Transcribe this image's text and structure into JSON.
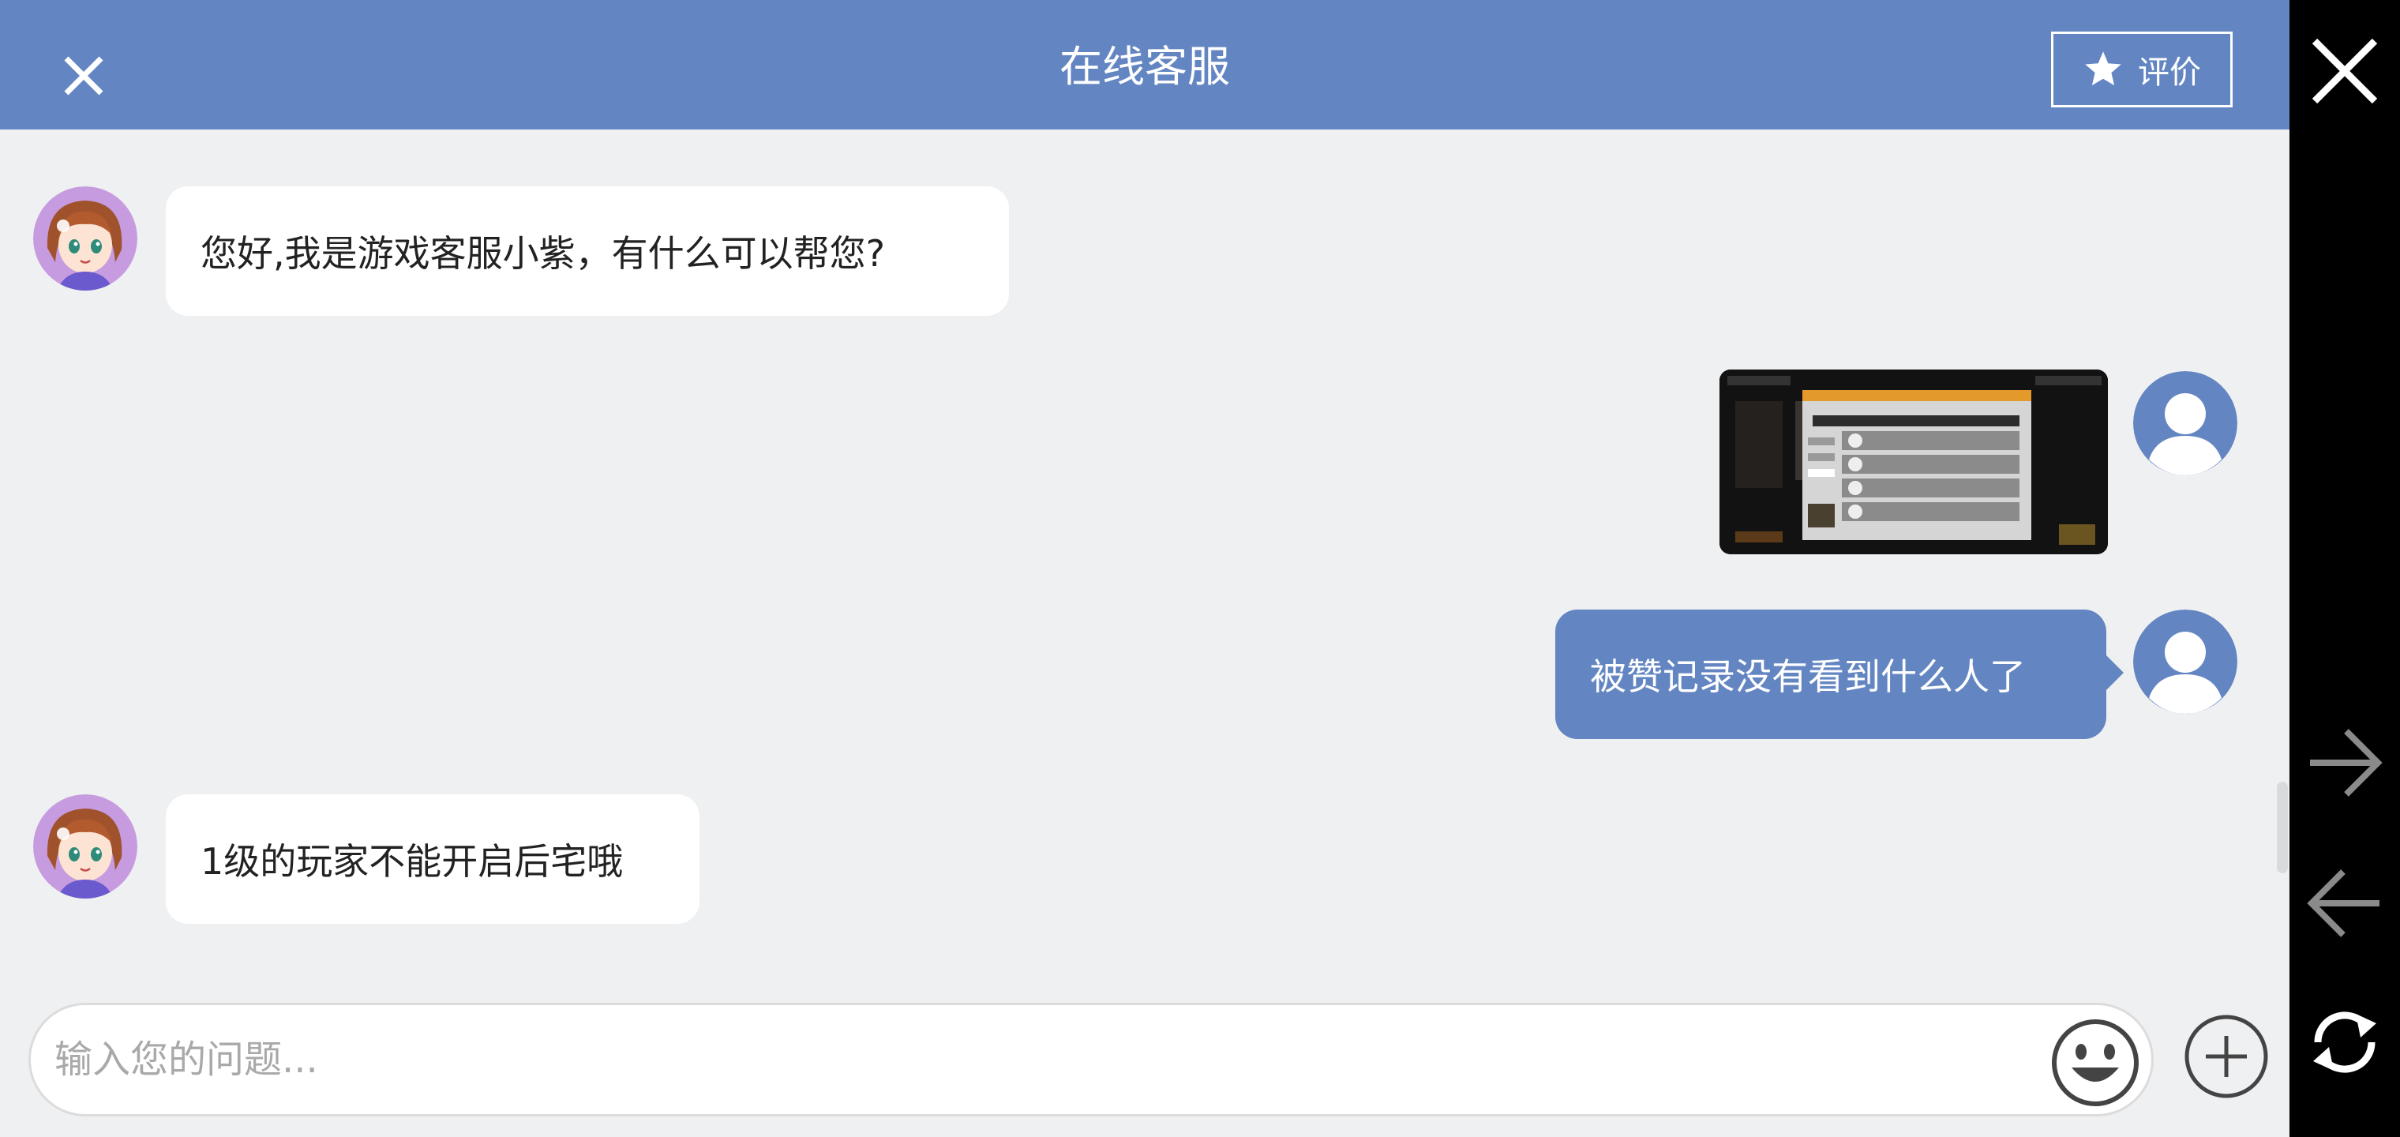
{
  "header": {
    "title": "在线客服",
    "rate_label": "评价",
    "close_icon": "close-icon",
    "star_icon": "star-icon"
  },
  "messages": [
    {
      "side": "agent",
      "text": "您好,我是游戏客服小紫，有什么可以帮您?"
    },
    {
      "side": "user",
      "type": "image",
      "content": "game-screenshot"
    },
    {
      "side": "user",
      "text": "被赞记录没有看到什么人了"
    },
    {
      "side": "agent",
      "text": "1级的玩家不能开启后宅哦"
    }
  ],
  "input": {
    "placeholder": "输入您的问题..."
  },
  "sidebar": {
    "icons": [
      "close-icon",
      "arrow-right-icon",
      "arrow-left-icon",
      "refresh-icon"
    ]
  },
  "colors": {
    "header": "#6386c2",
    "background": "#eff0f2",
    "user_bubble": "#6386c2",
    "agent_bubble": "#ffffff"
  }
}
